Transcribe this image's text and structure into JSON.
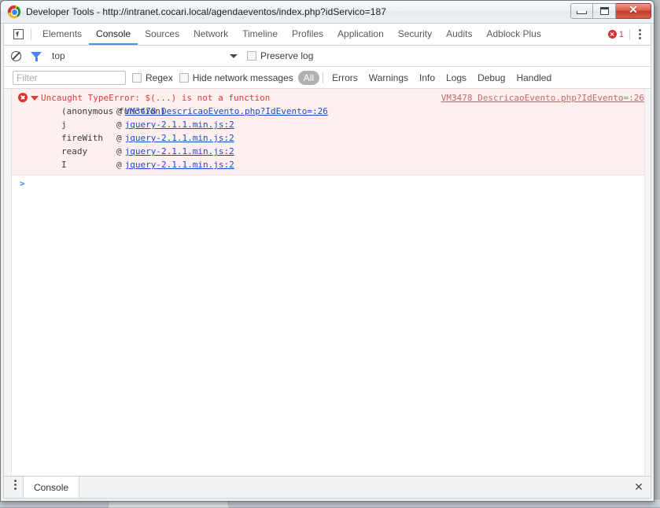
{
  "window": {
    "title": "Developer Tools - http://intranet.cocari.local/agendaeventos/index.php?idServico=187",
    "minimize_label": "Minimize",
    "maximize_label": "Maximize",
    "close_label": "✕"
  },
  "panel_toolbar": {
    "inspect_tooltip": "Select an element in the page to inspect it",
    "tabs": [
      {
        "label": "Elements",
        "active": false
      },
      {
        "label": "Console",
        "active": true
      },
      {
        "label": "Sources",
        "active": false
      },
      {
        "label": "Network",
        "active": false
      },
      {
        "label": "Timeline",
        "active": false
      },
      {
        "label": "Profiles",
        "active": false
      },
      {
        "label": "Application",
        "active": false
      },
      {
        "label": "Security",
        "active": false
      },
      {
        "label": "Audits",
        "active": false
      },
      {
        "label": "Adblock Plus",
        "active": false
      }
    ],
    "error_count": "1",
    "error_icon": "error-circle-icon",
    "menu_icon": "kebab-menu-icon"
  },
  "console_toolbar": {
    "clear_icon": "clear-console-icon",
    "filter_icon": "funnel-filter-icon",
    "context": "top",
    "preserve_log_label": "Preserve log",
    "preserve_log_checked": false
  },
  "filter_toolbar": {
    "filter_placeholder": "Filter",
    "filter_value": "",
    "regex_label": "Regex",
    "regex_checked": false,
    "hide_network_label": "Hide network messages",
    "hide_network_checked": false,
    "levels": [
      {
        "label": "All",
        "active": true
      },
      {
        "label": "Errors",
        "active": false
      },
      {
        "label": "Warnings",
        "active": false
      },
      {
        "label": "Info",
        "active": false
      },
      {
        "label": "Logs",
        "active": false
      },
      {
        "label": "Debug",
        "active": false
      },
      {
        "label": "Handled",
        "active": false
      }
    ]
  },
  "console": {
    "error": {
      "icon": "error-circle-icon",
      "expanded": true,
      "message": "Uncaught TypeError: $(...) is not a function",
      "source_link": "VM3478 DescricaoEvento.php?IdEvento=:26",
      "stack": [
        {
          "fn": "(anonymous function)",
          "at": "@",
          "link": "VM3478 DescricaoEvento.php?IdEvento=:26"
        },
        {
          "fn": "j",
          "at": "@",
          "link": "jquery-2.1.1.min.js:2"
        },
        {
          "fn": "fireWith",
          "at": "@",
          "link": "jquery-2.1.1.min.js:2"
        },
        {
          "fn": "ready",
          "at": "@",
          "link": "jquery-2.1.1.min.js:2"
        },
        {
          "fn": "I",
          "at": "@",
          "link": "jquery-2.1.1.min.js:2"
        }
      ]
    },
    "prompt_symbol": ">",
    "prompt_value": ""
  },
  "drawer": {
    "menu_icon": "kebab-menu-icon",
    "tab_label": "Console",
    "close_label": "✕"
  },
  "colors": {
    "accent_tab_underline": "#4a8df0",
    "error_red": "#e33b3b",
    "error_bg": "#fff0f0",
    "link_blue": "#1a4ad0",
    "filter_blue": "#3f87f5"
  }
}
